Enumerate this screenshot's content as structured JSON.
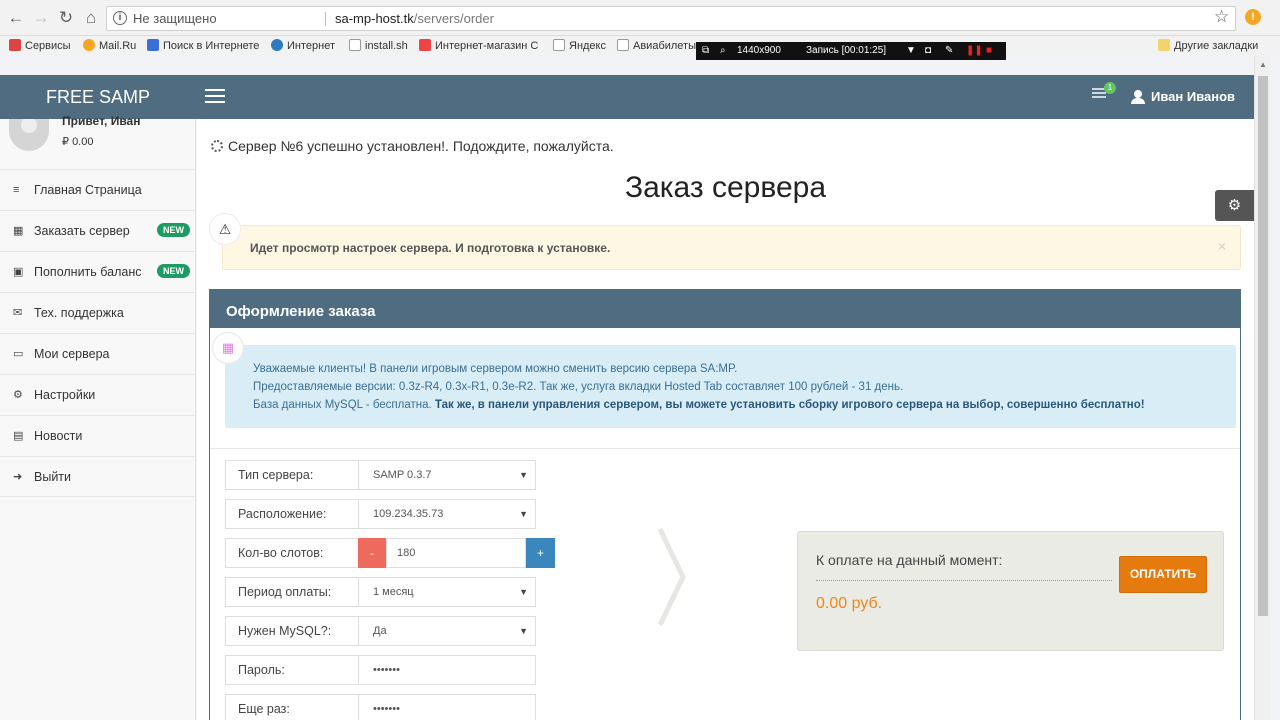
{
  "browser": {
    "security_label": "Не защищено",
    "url_host": "sa-mp-host.tk",
    "url_path": "/servers/order",
    "bookmarks": [
      {
        "label": "Сервисы",
        "color": "#d44"
      },
      {
        "label": "Mail.Ru",
        "color": "#f5a623"
      },
      {
        "label": "Поиск в Интернете",
        "color": "#3a6fd8"
      },
      {
        "label": "Интернет",
        "color": "#2c7bbf"
      },
      {
        "label": "install.sh",
        "color": "#999"
      },
      {
        "label": "Интернет-магазин С",
        "color": "#e44"
      },
      {
        "label": "Яндекс",
        "color": "#999"
      },
      {
        "label": "Авиабилеты",
        "color": "#999"
      },
      {
        "label": "Другие закладки",
        "color": "#f3d36b"
      }
    ]
  },
  "recorder": {
    "resolution": "1440x900",
    "status": "Запись [00:01:25]"
  },
  "header": {
    "brand": "FREE SAMP",
    "message_count": "1",
    "user_name": "Иван Иванов"
  },
  "sidebar": {
    "greeting": "Привет, Иван",
    "balance": "0.00",
    "items": [
      {
        "label": "Главная Страница",
        "icon": "≡",
        "badge": ""
      },
      {
        "label": "Заказать сервер",
        "icon": "▦",
        "badge": "NEW"
      },
      {
        "label": "Пополнить баланс",
        "icon": "▣",
        "badge": "NEW"
      },
      {
        "label": "Тех. поддержка",
        "icon": "✉",
        "badge": ""
      },
      {
        "label": "Мои сервера",
        "icon": "▭",
        "badge": ""
      },
      {
        "label": "Настройки",
        "icon": "⚙",
        "badge": ""
      },
      {
        "label": "Новости",
        "icon": "▤",
        "badge": ""
      },
      {
        "label": "Выйти",
        "icon": "➜",
        "badge": ""
      }
    ]
  },
  "main": {
    "loading_text": "Сервер №6 успешно установлен!. Подождите, пожалуйста.",
    "page_title": "Заказ сервера",
    "warning_text": "Идет просмотр настроек сервера. И подготовка к установке.",
    "close_symbol": "×"
  },
  "order_panel": {
    "title": "Оформление заказа",
    "info_line1": "Уважаемые клиенты! В панели игровым сервером можно сменить версию сервера SA:MP.",
    "info_line2": "Предоставляемые версии: 0.3z-R4, 0.3x-R1, 0.3e-R2. Так же, услуга вкладки Hosted Tab составляет 100 рублей - 31 день.",
    "info_line3_normal": "База данных MySQL - бесплатна. ",
    "info_line3_bold": "Так же, в панели управления сервером, вы можете установить сборку игрового сервера на выбор, совершенно бесплатно!",
    "form": {
      "server_type_label": "Тип сервера:",
      "server_type_value": "SAMP 0.3.7",
      "location_label": "Расположение:",
      "location_value": "109.234.35.73",
      "slots_label": "Кол-во слотов:",
      "slots_value": "180",
      "minus": "-",
      "plus": "+",
      "period_label": "Период оплаты:",
      "period_value": "1 месяц",
      "mysql_label": "Нужен MySQL?:",
      "mysql_value": "Да",
      "password_label": "Пароль:",
      "password_value": "•••••••",
      "repeat_label": "Еще раз:",
      "repeat_value": "•••••••"
    },
    "payment": {
      "label": "К оплате на данный момент:",
      "amount": "0.00 руб.",
      "button": "ОПЛАТИТЬ"
    }
  }
}
